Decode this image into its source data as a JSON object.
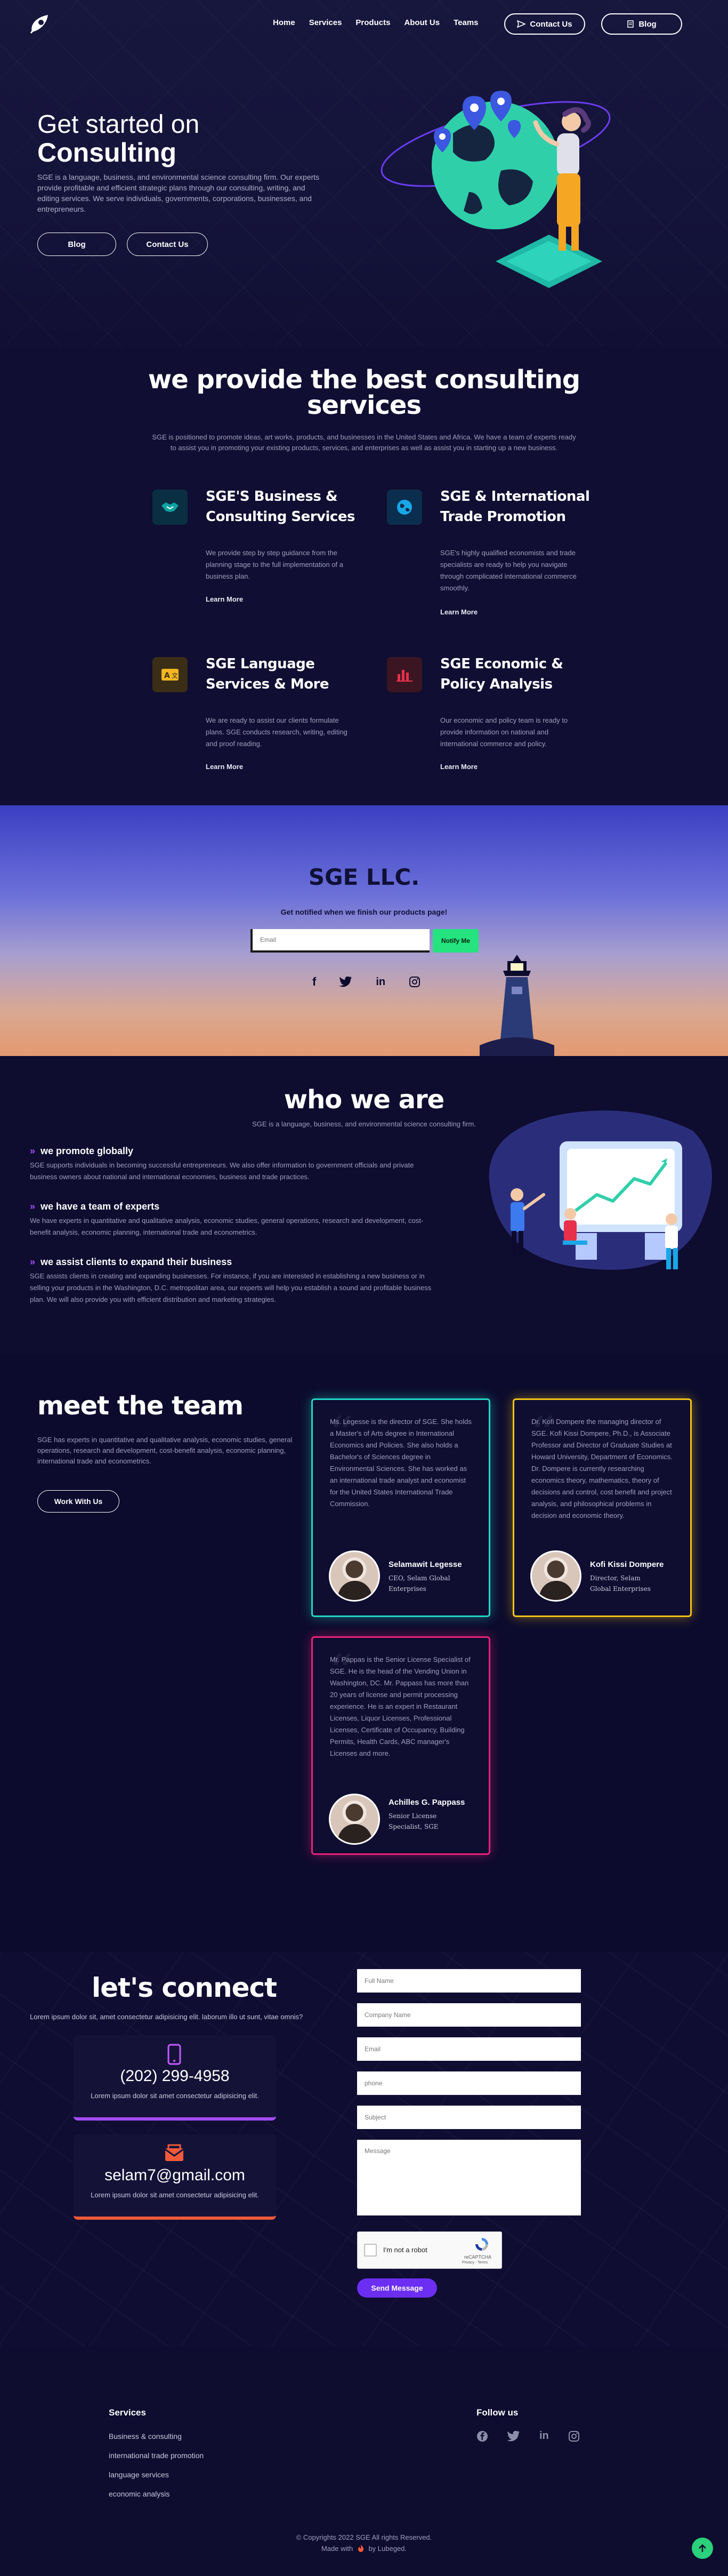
{
  "nav": {
    "items": [
      "Home",
      "Services",
      "Products",
      "About Us",
      "Teams"
    ],
    "contact_label": "Contact Us",
    "blog_label": "Blog"
  },
  "hero": {
    "title_line1": "Get started on",
    "title_line2": "Consulting",
    "text": "SGE is a language, business, and environmental science consulting firm. Our experts provide profitable and efficient strategic plans through our consulting, writing, and editing services. We serve individuals, governments, corporations, businesses, and entrepreneurs.",
    "blog_button": "Blog",
    "contact_button": "Contact Us"
  },
  "services": {
    "title_line1": "we provide the best consulting",
    "title_line2": "services",
    "subtitle": "SGE is positioned to promote ideas, art works, products, and businesses in the United States and Africa. We have a team of experts ready to assist you in promoting your existing products, services, and enterprises as well as assist you in starting up a new business.",
    "learn_more": "Learn More",
    "items": [
      {
        "title_line1": "SGE'S Business &",
        "title_line2": "Consulting Services",
        "text": "We provide step by step guidance from the planning stage to the full implementation of a business plan.",
        "icon": "handshake-icon",
        "color": "#0fa3a3"
      },
      {
        "title_line1": "SGE & International",
        "title_line2": "Trade Promotion",
        "text": "SGE's highly qualified economists and trade specialists are ready to help you navigate through complicated international commerce smoothly.",
        "icon": "globe-icon",
        "color": "#1aa7e8"
      },
      {
        "title_line1": "SGE Language",
        "title_line2": "Services & More",
        "text": "We are ready to assist our clients formulate plans. SGE conducts research, writing, editing and proof reading.",
        "icon": "translate-icon",
        "color": "#f3b623"
      },
      {
        "title_line1": "SGE Economic &",
        "title_line2": "Policy Analysis",
        "text": "Our economic and policy team is ready to provide information on national and international commerce and policy.",
        "icon": "bar-chart-icon",
        "color": "#e8304a"
      }
    ]
  },
  "newsletter": {
    "title": "SGE LLC.",
    "subtitle": "Get notified when we finish our products page!",
    "email_placeholder": "Email",
    "button": "Notify Me",
    "social": [
      "facebook-icon",
      "twitter-icon",
      "linkedin-icon",
      "instagram-icon"
    ]
  },
  "who": {
    "title": "who we are",
    "subtitle": "SGE is a language, business, and environmental science consulting firm.",
    "items": [
      {
        "title": "we promote globally",
        "text": "SGE supports individuals in becoming successful entrepreneurs. We also offer information to government officials and private business owners about national and international economies, business and trade practices."
      },
      {
        "title": "we have a team of experts",
        "text": "We have experts in quantitative and qualitative analysis, economic studies, general operations, research and development, cost-benefit analysis, economic planning, international trade and econometrics."
      },
      {
        "title": "we assist clients to expand their business",
        "text": "SGE assists clients in creating and expanding businesses. For instance, if you are interested in establishing a new business or in selling your products in the Washington, D.C. metropolitan area, our experts will help you establish a sound and profitable business plan. We will also provide you with efficient distribution and marketing strategies."
      }
    ]
  },
  "team": {
    "title": "meet the team",
    "text": "SGE has experts in quantitative and qualitative analysis, economic studies, general operations, research and development, cost-benefit analysis, economic planning, international trade and econometrics.",
    "button": "Work With Us",
    "members": [
      {
        "bio": "Ms. Legesse is the director of SGE. She holds a Master's of Arts degree in International Economics and Policies. She also holds a Bachelor's of Sciences degree in Environmental Sciences. She has worked as an international trade analyst and economist for the United States International Trade Commission.",
        "name": "Selamawit Legesse",
        "role": "CEO, Selam Global Enterprises",
        "color": "#1fd6c4"
      },
      {
        "bio": "Dr. Kofi Dompere the managing director of SGE. Kofi Kissi Dompere, Ph.D., is Associate Professor and Director of Graduate Studies at Howard University, Department of Economics. Dr. Dompere is currently researching economics theory, mathematics, theory of decisions and control, cost benefit and project analysis, and philosophical problems in decision and economic theory.",
        "name": "Kofi Kissi Dompere",
        "role": "Director, Selam Global Enterprises",
        "color": "#f2c318"
      },
      {
        "bio": "Mr. Pappas is the Senior License Specialist of SGE. He is the head of the Vending Union in Washington, DC. Mr. Pappass has more than 20 years of license and permit processing experience. He is an expert in Restaurant Licenses, Liquor Licenses, Professional Licenses, Certificate of Occupancy, Building Permits, Health Cards, ABC manager's Licenses and more.",
        "name": "Achilles G. Pappass",
        "role": "Senior License Specialist, SGE",
        "color": "#e8207a"
      }
    ]
  },
  "contact": {
    "title": "let's connect",
    "subtitle": "Lorem ipsum dolor sit, amet consectetur adipisicing elit. laborum illo ut sunt, vitae omnis?",
    "phone": "(202) 299-4958",
    "phone_caption": "Lorem ipsum dolor sit amet consectetur adipisicing elit.",
    "email": "selam7@gmail.com",
    "email_caption": "Lorem ipsum dolor sit amet consectetur adipisicing elit.",
    "placeholders": {
      "full_name": "Full Name",
      "company": "Company Name",
      "email": "Email",
      "phone": "phone",
      "subject": "Subject",
      "message": "Message"
    },
    "captcha_label": "I'm not a robot",
    "captcha_brand": "reCAPTCHA",
    "captcha_terms": "Privacy - Terms",
    "send_button": "Send Message"
  },
  "footer": {
    "services_heading": "Services",
    "services_links": [
      "Business & consulting",
      "international trade promotion",
      "language services",
      "economic analysis"
    ],
    "follow_heading": "Follow us",
    "copyright": "© Copyrights 2022 SGE All rights Reserved.",
    "made_with": "Made with",
    "made_by": "by Lubeged."
  }
}
